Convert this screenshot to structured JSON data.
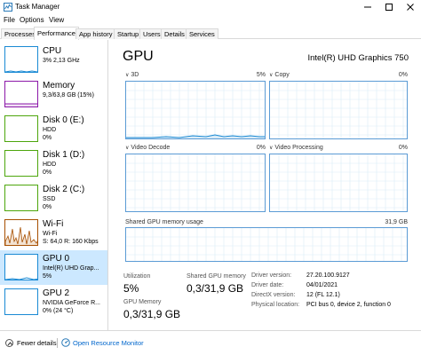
{
  "window": {
    "title": "Task Manager"
  },
  "menu": [
    "File",
    "Options",
    "View"
  ],
  "tabs": [
    {
      "label": "Processes",
      "active": false
    },
    {
      "label": "Performance",
      "active": true
    },
    {
      "label": "App history",
      "active": false
    },
    {
      "label": "Startup",
      "active": false
    },
    {
      "label": "Users",
      "active": false
    },
    {
      "label": "Details",
      "active": false
    },
    {
      "label": "Services",
      "active": false
    }
  ],
  "sidebar": [
    {
      "name": "CPU",
      "line1": "3% 2,13 GHz",
      "line2": "",
      "color": "#1a8ad4"
    },
    {
      "name": "Memory",
      "line1": "9,3/63,8 GB (15%)",
      "line2": "",
      "color": "#8b18a8"
    },
    {
      "name": "Disk 0 (E:)",
      "line1": "HDD",
      "line2": "0%",
      "color": "#4da60c"
    },
    {
      "name": "Disk 1 (D:)",
      "line1": "HDD",
      "line2": "0%",
      "color": "#4da60c"
    },
    {
      "name": "Disk 2 (C:)",
      "line1": "SSD",
      "line2": "0%",
      "color": "#4da60c"
    },
    {
      "name": "Wi-Fi",
      "line1": "Wi-Fi",
      "line2": "S: 64,0  R: 160 Kbps",
      "color": "#a74f01"
    },
    {
      "name": "GPU 0",
      "line1": "Intel(R) UHD Grap...",
      "line2": "5%",
      "color": "#1a8ad4"
    },
    {
      "name": "GPU 2",
      "line1": "NVIDIA GeForce R...",
      "line2": "0% (24 °C)",
      "color": "#1a8ad4"
    }
  ],
  "main": {
    "title": "GPU",
    "model": "Intel(R) UHD Graphics 750",
    "graphs": [
      {
        "label": "3D",
        "pct": "5%"
      },
      {
        "label": "Copy",
        "pct": "0%"
      },
      {
        "label": "Video Decode",
        "pct": "0%"
      },
      {
        "label": "Video Processing",
        "pct": "0%"
      }
    ],
    "shared_label": "Shared GPU memory usage",
    "shared_value": "31,9 GB",
    "stats": {
      "utilization_label": "Utilization",
      "utilization_value": "5%",
      "shared_mem_label": "Shared GPU memory",
      "shared_mem_value": "0,3/31,9 GB",
      "gpu_mem_label": "GPU Memory",
      "gpu_mem_value": "0,3/31,9 GB"
    },
    "info": [
      {
        "label": "Driver version:",
        "value": "27.20.100.9127"
      },
      {
        "label": "Driver date:",
        "value": "04/01/2021"
      },
      {
        "label": "DirectX version:",
        "value": "12 (FL 12.1)"
      },
      {
        "label": "Physical location:",
        "value": "PCI bus 0, device 2, function 0"
      }
    ]
  },
  "footer": {
    "fewer_details": "Fewer details",
    "open_monitor": "Open Resource Monitor"
  },
  "colors": {
    "graph_border": "#5b9bd5",
    "graph_grid": "#d9ebf7",
    "selection": "#cce8ff"
  }
}
